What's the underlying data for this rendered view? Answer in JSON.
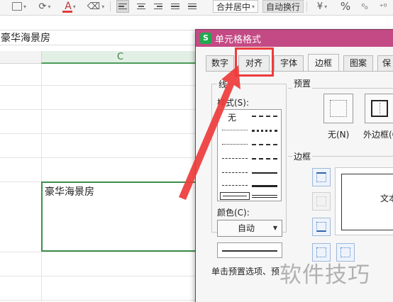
{
  "toolbar": {
    "merge_center_label": "合并居中",
    "auto_wrap_label": "自动换行",
    "currency_symbol": "¥",
    "percent_symbol": "%",
    "font_color_letter": "A",
    "font_color_bar": "#e03c3c",
    "active_tool_bg": "#d9d9d9"
  },
  "formula_bar": {
    "content": "豪华海景房"
  },
  "sheet": {
    "column_header": "C",
    "selected_cell_text": "豪华海景房",
    "selection_color": "#3c8f4c"
  },
  "dialog": {
    "title": "单元格格式",
    "icon_letter": "S",
    "title_bar_color": "#c34a84",
    "tabs": [
      "数字",
      "对齐",
      "字体",
      "边框",
      "图案",
      "保"
    ],
    "active_tab": "边框",
    "line_group_label": "线",
    "style_label": "样式(S):",
    "style_none": "无",
    "color_label": "颜色(C):",
    "color_value": "自动",
    "preset_group_label": "预置",
    "preset_none_label": "无(N)",
    "preset_outer_label": "外边框(O",
    "border_group_label": "边框",
    "preview_text": "文本",
    "hint_text": "单击预置选项、预"
  },
  "annotation": {
    "highlight_color": "#ee3b3b",
    "highlighted_tab": "对齐"
  },
  "watermark": {
    "text": "软件技巧"
  }
}
